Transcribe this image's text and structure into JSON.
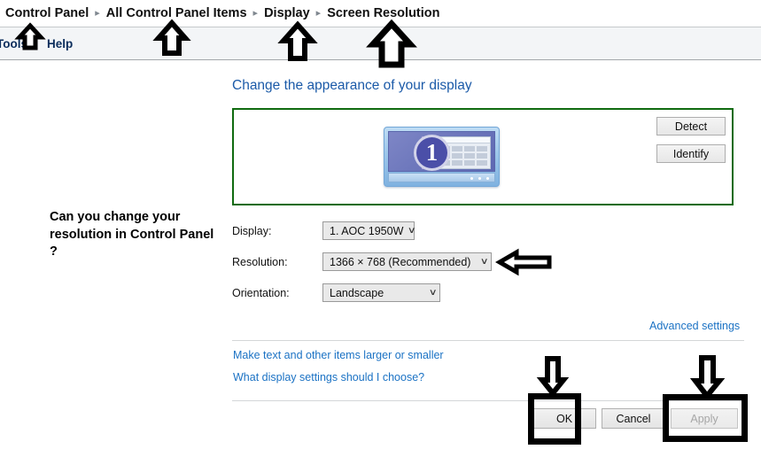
{
  "breadcrumb": {
    "items": [
      {
        "label": "Control Panel"
      },
      {
        "label": "All Control Panel Items"
      },
      {
        "label": "Display"
      },
      {
        "label": "Screen Resolution"
      }
    ],
    "separator": "▸"
  },
  "menu": {
    "items": [
      {
        "label": "Tools"
      },
      {
        "label": "Help"
      }
    ]
  },
  "page": {
    "title": "Change the appearance of your display"
  },
  "preview": {
    "monitor_number": "1",
    "border_color": "#106b10",
    "buttons": [
      {
        "label": "Detect"
      },
      {
        "label": "Identify"
      }
    ]
  },
  "form": {
    "display": {
      "label": "Display:",
      "value": "1. AOC 1950W"
    },
    "resolution": {
      "label": "Resolution:",
      "value": "1366 × 768 (Recommended)"
    },
    "orientation": {
      "label": "Orientation:",
      "value": "Landscape"
    },
    "chevron": "∨"
  },
  "links": {
    "advanced_settings": "Advanced settings",
    "make_text": "Make text and other items larger or smaller",
    "what_settings": "What display settings should I choose?",
    "color": "#1b72c4"
  },
  "dialog_buttons": {
    "ok": "OK",
    "cancel": "Cancel",
    "apply": "Apply",
    "apply_disabled": true
  },
  "annotations": {
    "question": "Can you change your resolution in Control Panel ?",
    "arrow_color": "#000000"
  }
}
